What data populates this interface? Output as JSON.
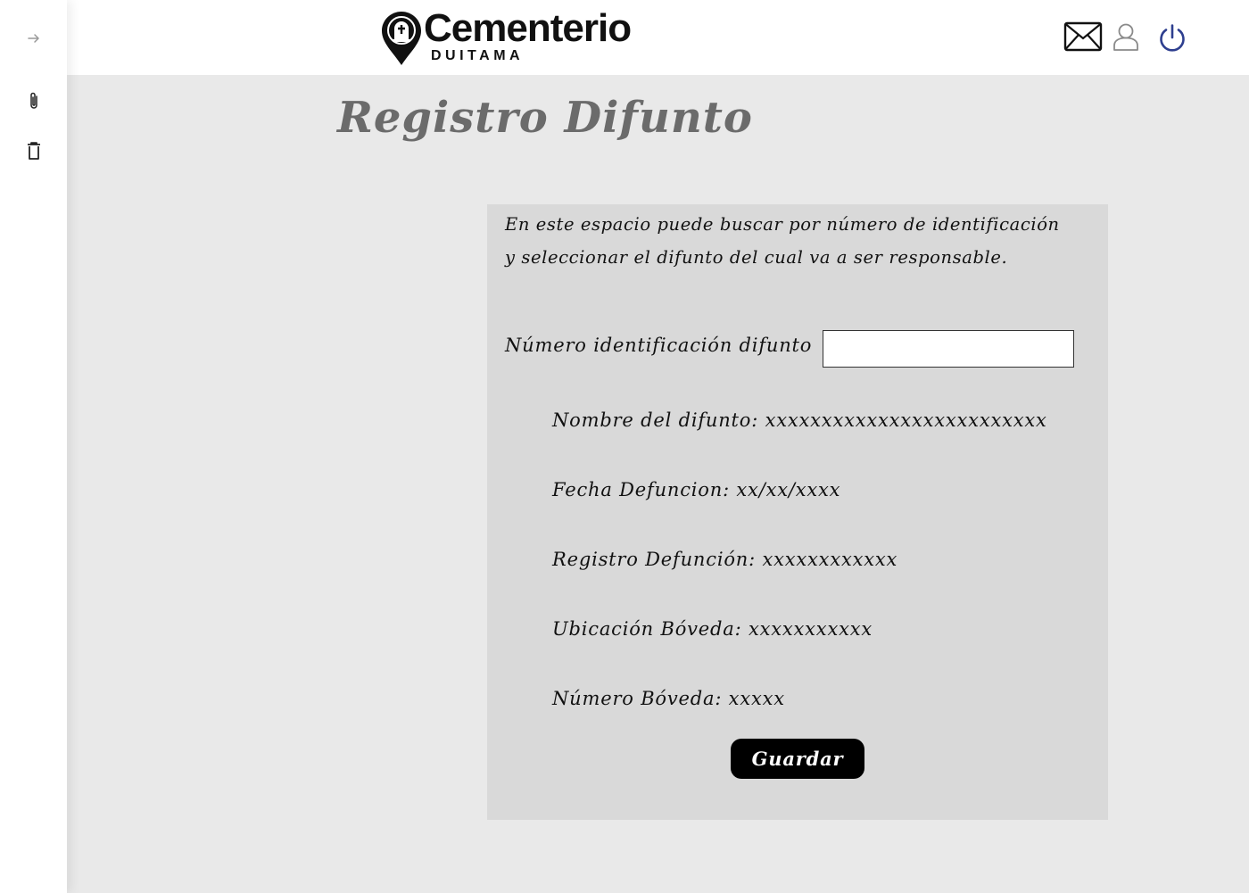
{
  "sidebar": {
    "icons": [
      "arrow-right-icon",
      "paperclip-icon",
      "trash-icon"
    ]
  },
  "header": {
    "logo_main": "Cementerio",
    "logo_sub": "DUITAMA",
    "icons": [
      "mail-icon",
      "user-icon",
      "power-icon"
    ],
    "power_color": "#2e3f8f"
  },
  "page": {
    "title": "Registro Difunto"
  },
  "form": {
    "intro_line1": "En este espacio puede buscar por número de identificación",
    "intro_line2": "y seleccionar el difunto del cual va a ser responsable.",
    "id_label": "Número identificación difunto",
    "id_value": "",
    "details": [
      "Nombre del difunto: xxxxxxxxxxxxxxxxxxxxxxxxx",
      "Fecha Defuncion: xx/xx/xxxx",
      "Registro Defunción: xxxxxxxxxxxx",
      "Ubicación Bóveda: xxxxxxxxxxx",
      "Número Bóveda: xxxxx"
    ],
    "save_label": "Guardar"
  }
}
